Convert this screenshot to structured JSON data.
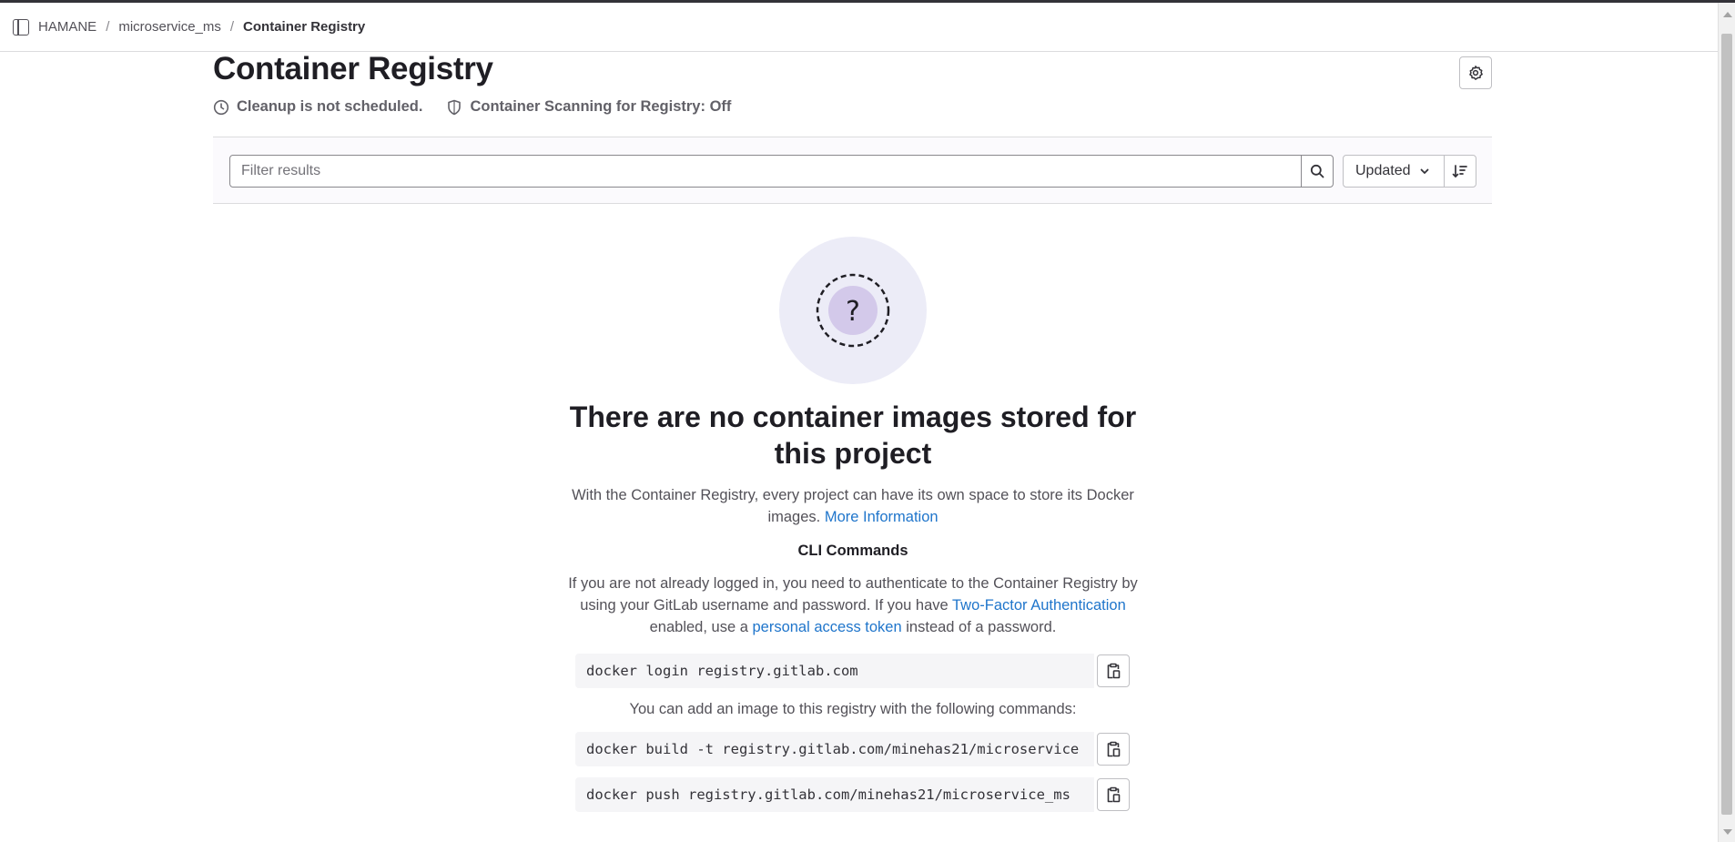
{
  "breadcrumb": {
    "items": [
      "HAMANE",
      "microservice_ms",
      "Container Registry"
    ],
    "separator": "/"
  },
  "header": {
    "title": "Container Registry",
    "cleanup_status": "Cleanup is not scheduled.",
    "scanning_status": "Container Scanning for Registry: Off"
  },
  "filter": {
    "placeholder": "Filter results",
    "sort_label": "Updated"
  },
  "empty_state": {
    "title": "There are no container images stored for this project",
    "description": "With the Container Registry, every project can have its own space to store its Docker images.",
    "more_info_link": "More Information",
    "cli_heading": "CLI Commands",
    "login_text_1": "If you are not already logged in, you need to authenticate to the Container Registry by using your GitLab username and password. If you have",
    "two_factor_link": "Two-Factor Authentication",
    "login_text_2": "enabled, use a",
    "pat_link": "personal access token",
    "login_text_3": "instead of a password.",
    "add_image_text": "You can add an image to this registry with the following commands:",
    "commands": {
      "login": "docker login registry.gitlab.com",
      "build": "docker build -t registry.gitlab.com/minehas21/microservice",
      "push": "docker push registry.gitlab.com/minehas21/microservice_ms"
    }
  },
  "colors": {
    "link": "#1f75cb",
    "illustration_bg": "#ececf7",
    "illustration_inner": "#d3c9ea"
  },
  "icons": [
    "sidebar-toggle-icon",
    "settings-icon",
    "clock-icon",
    "shield-icon",
    "search-icon",
    "chevron-down-icon",
    "sort-lowest-icon",
    "copy-to-clipboard-icon"
  ]
}
